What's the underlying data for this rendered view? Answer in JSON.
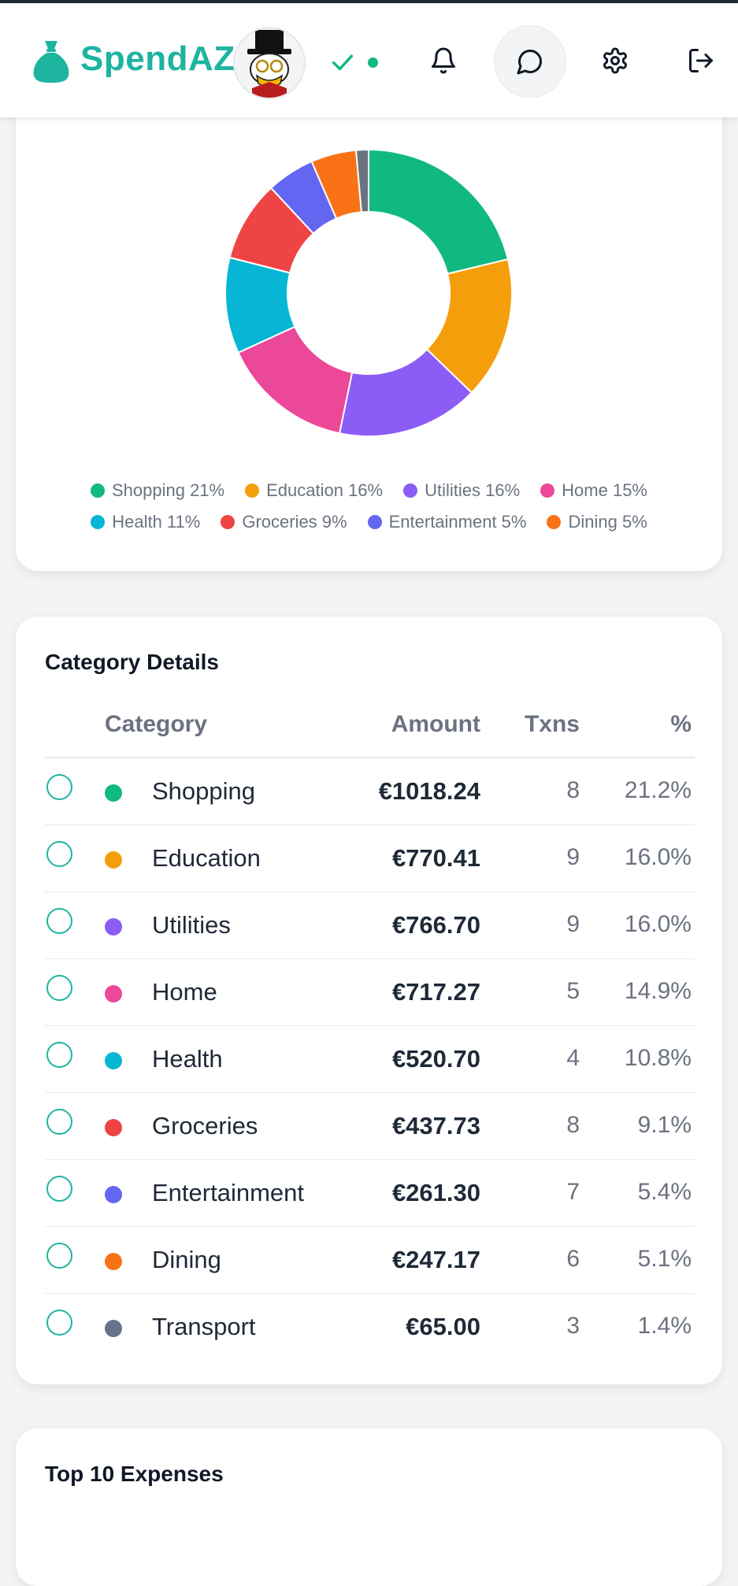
{
  "header": {
    "brand": "SpendAZ",
    "online_color": "#10b981",
    "icons": [
      "moneybag-icon",
      "avatar",
      "check-icon",
      "bell-icon",
      "chat-icon",
      "gear-icon",
      "logout-icon"
    ]
  },
  "chart_data": {
    "type": "pie",
    "categories": [
      "Shopping",
      "Education",
      "Utilities",
      "Home",
      "Health",
      "Groceries",
      "Entertainment",
      "Dining",
      "Transport"
    ],
    "values": [
      21.2,
      16.0,
      16.0,
      14.9,
      10.8,
      9.1,
      5.4,
      5.1,
      1.4
    ],
    "colors": [
      "#10b981",
      "#f59e0b",
      "#8b5cf6",
      "#ec4899",
      "#06b6d4",
      "#ef4444",
      "#6366f1",
      "#f97316",
      "#6b7280"
    ],
    "legend": [
      "Shopping 21%",
      "Education 16%",
      "Utilities 16%",
      "Home 15%",
      "Health 11%",
      "Groceries 9%",
      "Entertainment 5%",
      "Dining 5%"
    ],
    "legend_position": "bottom",
    "title": ""
  },
  "details": {
    "title": "Category Details",
    "columns": {
      "category": "Category",
      "amount": "Amount",
      "txns": "Txns",
      "pct": "%"
    },
    "rows": [
      {
        "name": "Shopping",
        "amount": "€1018.24",
        "txns": "8",
        "pct": "21.2%",
        "color": "#10b981"
      },
      {
        "name": "Education",
        "amount": "€770.41",
        "txns": "9",
        "pct": "16.0%",
        "color": "#f59e0b"
      },
      {
        "name": "Utilities",
        "amount": "€766.70",
        "txns": "9",
        "pct": "16.0%",
        "color": "#8b5cf6"
      },
      {
        "name": "Home",
        "amount": "€717.27",
        "txns": "5",
        "pct": "14.9%",
        "color": "#ec4899"
      },
      {
        "name": "Health",
        "amount": "€520.70",
        "txns": "4",
        "pct": "10.8%",
        "color": "#06b6d4"
      },
      {
        "name": "Groceries",
        "amount": "€437.73",
        "txns": "8",
        "pct": "9.1%",
        "color": "#ef4444"
      },
      {
        "name": "Entertainment",
        "amount": "€261.30",
        "txns": "7",
        "pct": "5.4%",
        "color": "#6366f1"
      },
      {
        "name": "Dining",
        "amount": "€247.17",
        "txns": "6",
        "pct": "5.1%",
        "color": "#f97316"
      },
      {
        "name": "Transport",
        "amount": "€65.00",
        "txns": "3",
        "pct": "1.4%",
        "color": "#64748b"
      }
    ]
  },
  "top_expenses": {
    "title": "Top 10 Expenses"
  }
}
